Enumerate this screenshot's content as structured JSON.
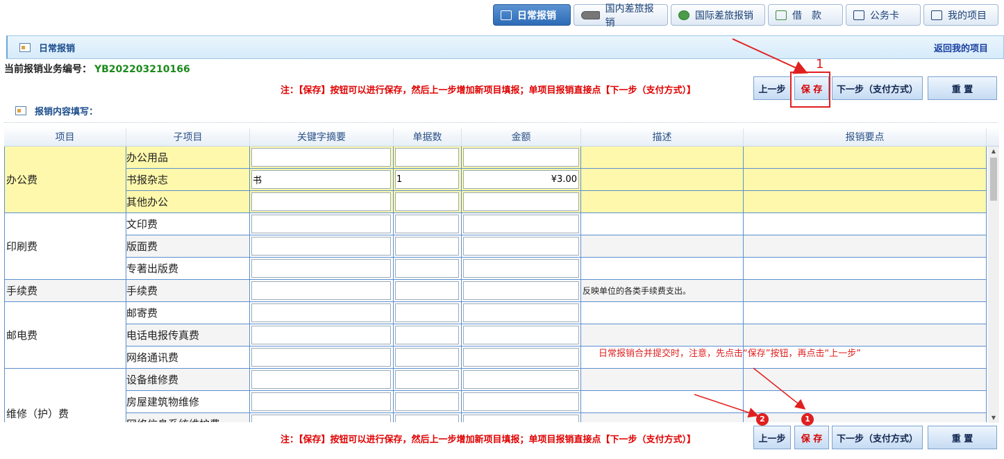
{
  "top_tabs": [
    {
      "label": "日常报销",
      "icon": "notebook-icon",
      "active": true
    },
    {
      "label": "国内差旅报销",
      "icon": "train-icon",
      "active": false
    },
    {
      "label": "国际差旅报销",
      "icon": "globe-icon",
      "active": false
    },
    {
      "label": "借　款",
      "icon": "cash-icon",
      "active": false
    },
    {
      "label": "公务卡",
      "icon": "card-icon",
      "active": false
    },
    {
      "label": "我的项目",
      "icon": "list-icon",
      "active": false
    }
  ],
  "section": {
    "title": "日常报销",
    "back_link": "返回我的项目"
  },
  "business_no": {
    "label": "当前报销业务编号：",
    "value": "YB202203210166"
  },
  "note": "注：【保存】按钮可以进行保存，然后上一步增加新项目填报；单项目报销直接点【下一步（支付方式）】",
  "buttons": {
    "prev": "上一步",
    "save": "保 存",
    "next": "下一步（支付方式）",
    "reset": "重 置"
  },
  "fill_title": "报销内容填写：",
  "table": {
    "headers": [
      "项目",
      "子项目",
      "关键字摘要",
      "单据数",
      "金额",
      "描述",
      "报销要点"
    ],
    "categories": [
      "办公费",
      "印刷费",
      "手续费",
      "邮电费",
      "维修（护）费"
    ],
    "rows": [
      {
        "sub": "办公用品",
        "key": "",
        "count": "",
        "amount": "",
        "desc": ""
      },
      {
        "sub": "书报杂志",
        "key": "书",
        "count": "1",
        "amount": "¥3.00",
        "desc": ""
      },
      {
        "sub": "其他办公",
        "key": "",
        "count": "",
        "amount": "",
        "desc": ""
      },
      {
        "sub": "文印费",
        "key": "",
        "count": "",
        "amount": "",
        "desc": ""
      },
      {
        "sub": "版面费",
        "key": "",
        "count": "",
        "amount": "",
        "desc": ""
      },
      {
        "sub": "专著出版费",
        "key": "",
        "count": "",
        "amount": "",
        "desc": ""
      },
      {
        "sub": "手续费",
        "key": "",
        "count": "",
        "amount": "",
        "desc": "反映单位的各类手续费支出。"
      },
      {
        "sub": "邮寄费",
        "key": "",
        "count": "",
        "amount": "",
        "desc": ""
      },
      {
        "sub": "电话电报传真费",
        "key": "",
        "count": "",
        "amount": "",
        "desc": ""
      },
      {
        "sub": "网络通讯费",
        "key": "",
        "count": "",
        "amount": "",
        "desc": ""
      },
      {
        "sub": "设备维修费",
        "key": "",
        "count": "",
        "amount": "",
        "desc": ""
      },
      {
        "sub": "房屋建筑物维修",
        "key": "",
        "count": "",
        "amount": "",
        "desc": ""
      },
      {
        "sub": "网络信息系统维护费",
        "key": "",
        "count": "",
        "amount": "",
        "desc": ""
      }
    ]
  },
  "annotations": {
    "top_number": "1",
    "bottom_text": "日常报销合并提交时，注意，先点击“保存”按钮，再点击“上一步”",
    "badge_1": "1",
    "badge_2": "2",
    "color": "#e02020"
  }
}
